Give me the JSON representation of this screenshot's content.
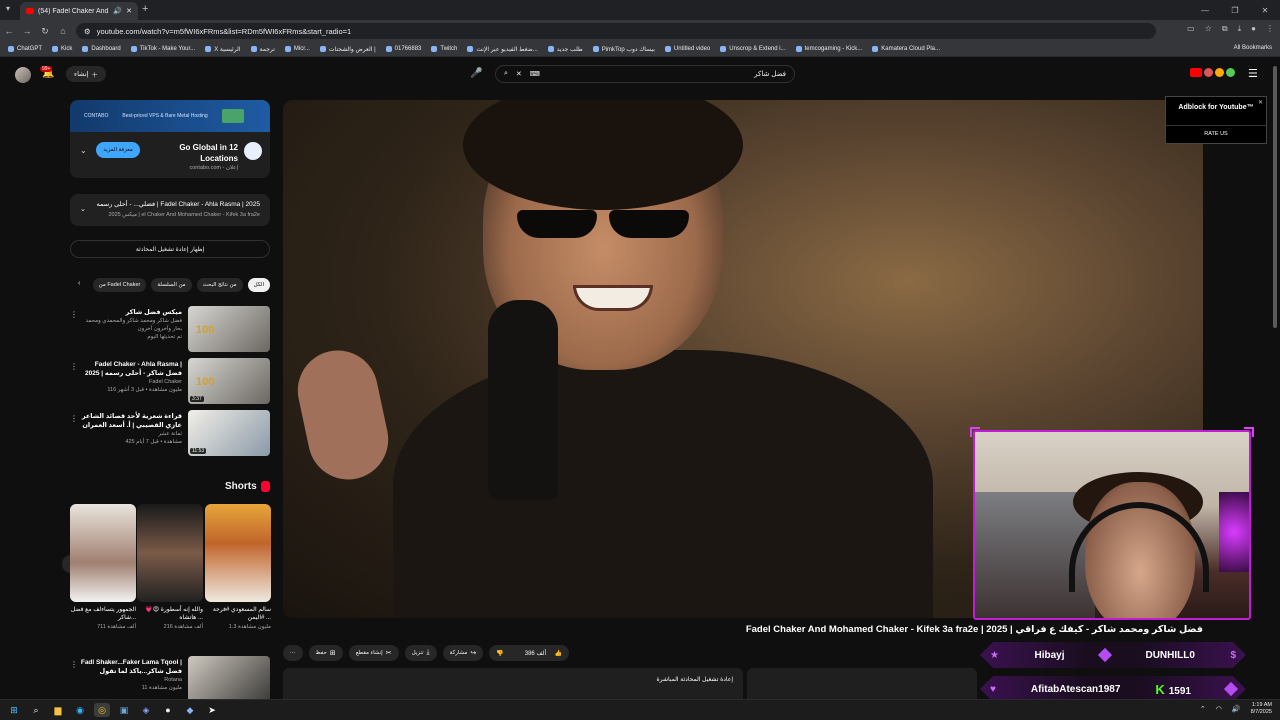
{
  "browser": {
    "tab_title": "(54) Fadel Chaker And Mo",
    "url": "youtube.com/watch?v=m5fWI6xFRms&list=RDm5fWI6xFRms&start_radio=1",
    "bookmarks": [
      "ChatGPT",
      "Kick",
      "Dashboard",
      "TikTok - Make Your...",
      "X الرئيسية",
      "ترجمة",
      "Micr...",
      "العرض والشحنات |",
      "01766883",
      "Twitch",
      "ضغط الفيديو عبر الإنت...",
      "طلب جديد",
      "PimkTop بيساك دوب",
      "Untitled video",
      "Unscrop & Extend i...",
      "temcogaming - Kick...",
      "Kamatera Cloud Pla..."
    ],
    "all_bookmarks": "All Bookmarks"
  },
  "header": {
    "notif_count": "99+",
    "create_label": "إنشاء",
    "search_query": "فضل شاكر",
    "search_kbd": "⌨"
  },
  "ad": {
    "banner_text": "Best-priced VPS & Bare Metal Hosting",
    "brand": "CONTABO",
    "title": "Go Global in 12 Locations",
    "sponsor": "contabo.com - إعلان",
    "cta": "معرفة المزيد"
  },
  "playlist": {
    "line1": "فضلي... - أحلى رسمه | Fadel Chaker - Ahla Rasma | 2025",
    "line2": "ميكس 2025 | el Chaker And Mohamed Chaker - Kifek 3a fra2e"
  },
  "live_chat_button": "إظهار إعادة تشغيل المحادثة",
  "chips": [
    "الكل",
    "من نتائج البحث",
    "من السلسلة",
    "من Fadel Chaker"
  ],
  "recommendations": [
    {
      "title": "ميكس فضل شاكر",
      "sub1": "فضل شاكر ومحمد شاكر والمحمدي ومحمد بحار وآخرون آخرون",
      "sub2": "تم تحديثها اليوم",
      "duration": "",
      "badge": "100"
    },
    {
      "title": "Fadel Chaker - Ahla Rasma | فضل شاكر - أحلى رسمه | 2025",
      "sub1": "Fadel Chaker",
      "sub2": "116 مليون مشاهدة • قبل 3 أشهر",
      "duration": "3:37",
      "badge": "100"
    },
    {
      "title": "قراءة شعرية لأحد قصائد الشاعر عازي القصيبي | أ. أسعد العمران",
      "sub1": "ثمانة عشر",
      "sub2": "425 مشاهدة • قبل 7 أيام",
      "duration": "11:53",
      "badge": ""
    }
  ],
  "shorts": {
    "title": "Shorts",
    "items": [
      {
        "title": "سالم المسعودي #فرحة #اليمن ...",
        "views": "1.3 مليون مشاهدة"
      },
      {
        "title": "والله إنه أسطورة 😍💗 هاتشاه ...",
        "views": "216 ألف مشاهدة"
      },
      {
        "title": "الجمهور يتساءلف مع فضل شاكر...",
        "views": "711 ألف مشاهدة"
      }
    ]
  },
  "rec_bottom": {
    "title": "Fadl Shaker...Faker Lama Tqool | فضل شاكر...ياكذ لما تقول",
    "channel": "Rotana",
    "views": "11 مليون مشاهدة"
  },
  "video": {
    "title": "Fadel Chaker And Mohamed Chaker - Kifek 3a fra2e | 2025 | فضل شاكر ومحمد شاكر - كيفك ع فراقي",
    "likes": "386 ألف",
    "actions": [
      "مشاركة",
      "تنزيل",
      "إنشاء مقطع",
      "حفظ"
    ],
    "chat_replay": "إعادة تشغيل المحادثة المباشرة"
  },
  "adblock": {
    "title": "Adblock for Youtube™",
    "rate": "RATE US"
  },
  "overlay": {
    "row1_left": "Hibayj",
    "row1_right": "DUNHILL0",
    "row2_left": "AfitabAtescan1987",
    "row2_right": "1591"
  },
  "taskbar": {
    "time": "1:19 AM",
    "date": "8/7/2025"
  }
}
